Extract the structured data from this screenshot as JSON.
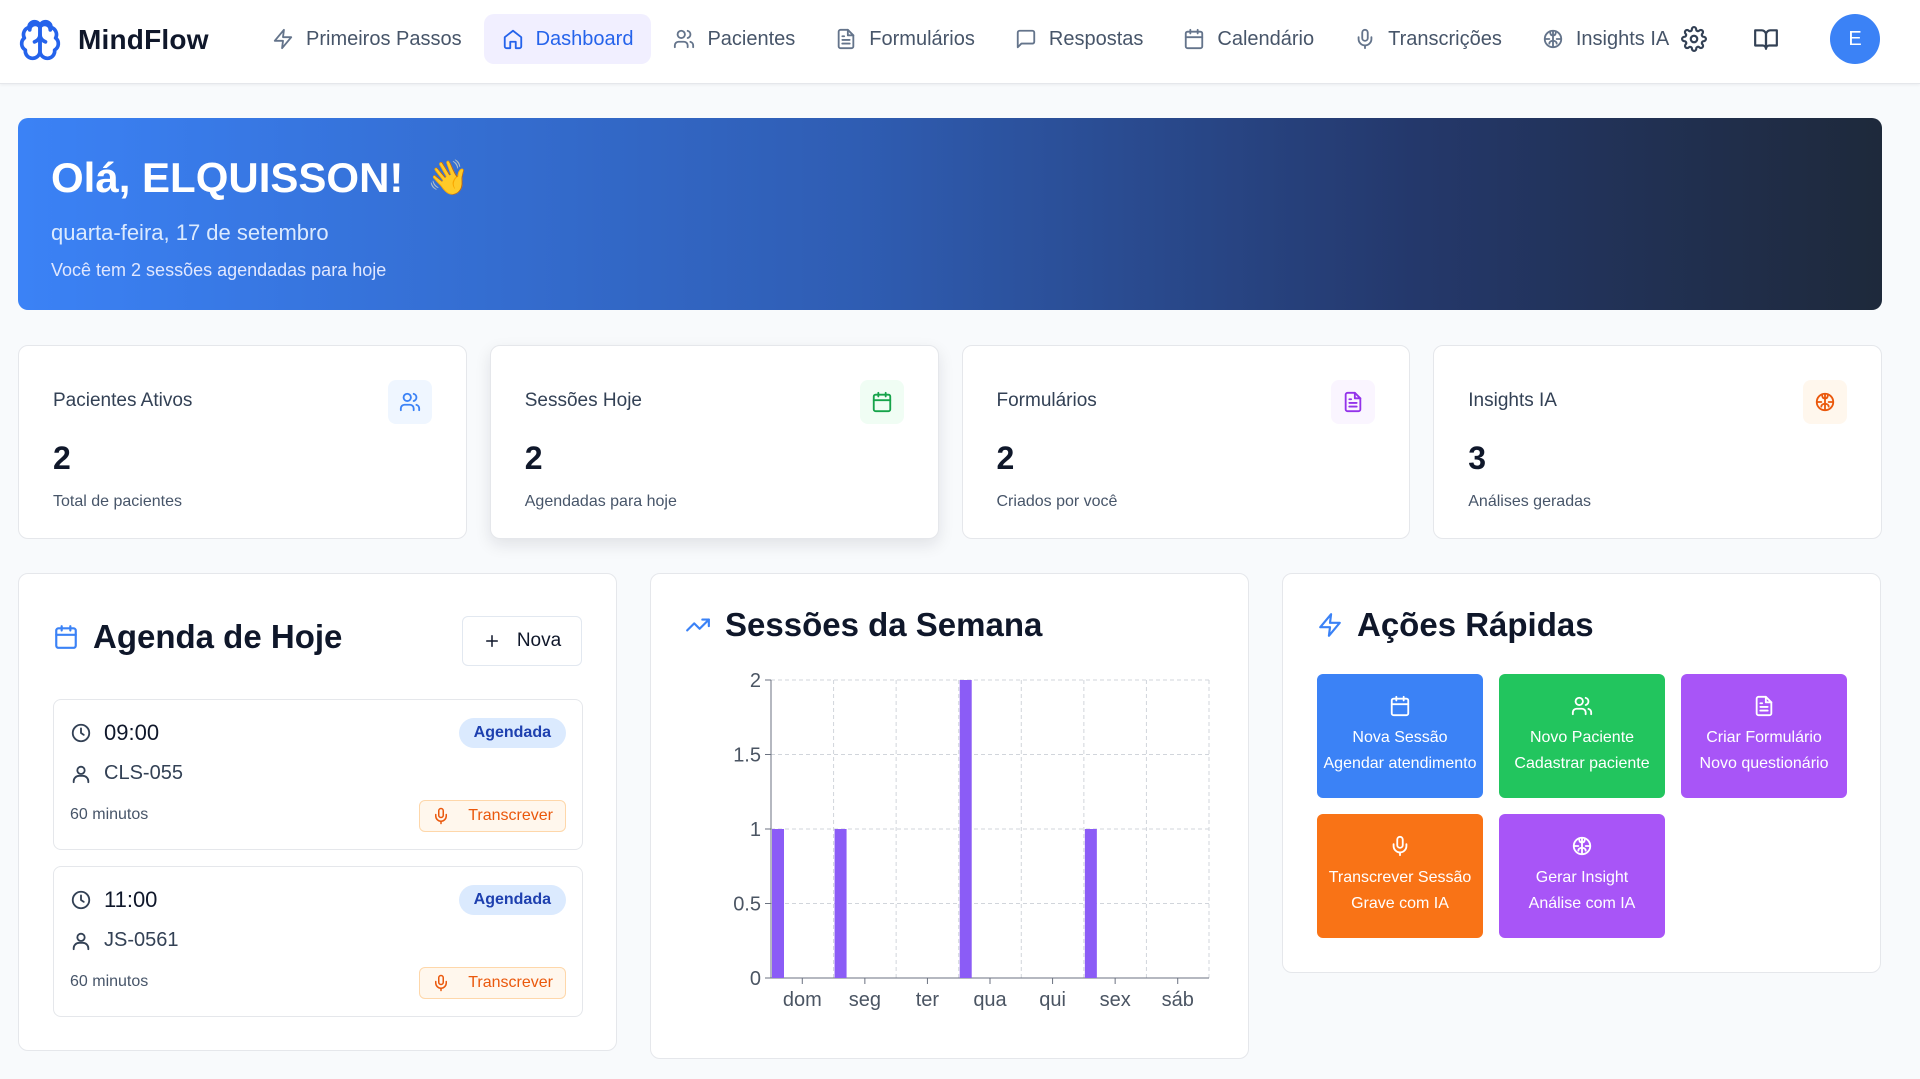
{
  "app": {
    "name": "MindFlow"
  },
  "nav": {
    "items": [
      {
        "label": "Primeiros Passos",
        "icon": "zap-icon"
      },
      {
        "label": "Dashboard",
        "icon": "home-icon",
        "active": true
      },
      {
        "label": "Pacientes",
        "icon": "users-icon"
      },
      {
        "label": "Formulários",
        "icon": "file-icon"
      },
      {
        "label": "Respostas",
        "icon": "message-icon"
      },
      {
        "label": "Calendário",
        "icon": "calendar-icon"
      },
      {
        "label": "Transcrições",
        "icon": "mic-icon"
      },
      {
        "label": "Insights IA",
        "icon": "brain-icon"
      }
    ],
    "avatar_initial": "E"
  },
  "hero": {
    "greeting": "Olá, ELQUISSON!",
    "emoji": "👋",
    "date": "quarta-feira, 17 de setembro",
    "subtitle": "Você tem 2 sessões agendadas para hoje"
  },
  "stats": [
    {
      "label": "Pacientes Ativos",
      "value": "2",
      "caption": "Total de pacientes",
      "icon": "users-icon",
      "color": "#3b82f6",
      "bg": "#eff6ff"
    },
    {
      "label": "Sessões Hoje",
      "value": "2",
      "caption": "Agendadas para hoje",
      "icon": "calendar-icon",
      "color": "#16a34a",
      "bg": "#f0fdf4"
    },
    {
      "label": "Formulários",
      "value": "2",
      "caption": "Criados por você",
      "icon": "file-icon",
      "color": "#9333ea",
      "bg": "#faf5ff"
    },
    {
      "label": "Insights IA",
      "value": "3",
      "caption": "Análises geradas",
      "icon": "brain-icon",
      "color": "#ea580c",
      "bg": "#fff7ed"
    }
  ],
  "agenda": {
    "title": "Agenda de Hoje",
    "new_label": "Nova",
    "appointments": [
      {
        "time": "09:00",
        "patient": "CLS-055",
        "duration": "60 minutos",
        "status": "Agendada",
        "action": "Transcrever"
      },
      {
        "time": "11:00",
        "patient": "JS-0561",
        "duration": "60 minutos",
        "status": "Agendada",
        "action": "Transcrever"
      }
    ]
  },
  "week": {
    "title": "Sessões da Semana"
  },
  "chart_data": {
    "type": "bar",
    "categories": [
      "dom",
      "seg",
      "ter",
      "qua",
      "qui",
      "sex",
      "sáb"
    ],
    "values": [
      1,
      1,
      0,
      2,
      0,
      1,
      0
    ],
    "ylim": [
      0,
      2
    ],
    "yticks": [
      "0",
      "0.5",
      "1",
      "1.5",
      "2"
    ],
    "title": "",
    "xlabel": "",
    "ylabel": "",
    "bar_color": "#8b5cf6",
    "grid": true
  },
  "quick": {
    "title": "Ações Rápidas",
    "actions": [
      {
        "title": "Nova Sessão",
        "subtitle": "Agendar atendimento",
        "icon": "calendar-icon",
        "color": "#3b82f6"
      },
      {
        "title": "Novo Paciente",
        "subtitle": "Cadastrar paciente",
        "icon": "users-icon",
        "color": "#22c55e"
      },
      {
        "title": "Criar Formulário",
        "subtitle": "Novo questionário",
        "icon": "file-icon",
        "color": "#a855f7"
      },
      {
        "title": "Transcrever Sessão",
        "subtitle": "Grave com IA",
        "icon": "mic-icon",
        "color": "#f97316"
      },
      {
        "title": "Gerar Insight",
        "subtitle": "Análise com IA",
        "icon": "brain-icon",
        "color": "#a855f7"
      }
    ]
  }
}
